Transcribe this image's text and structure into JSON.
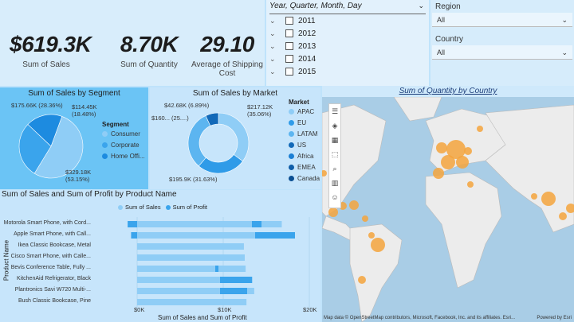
{
  "kpis": {
    "sales": {
      "value": "$619.3K",
      "label": "Sum of Sales"
    },
    "quantity": {
      "value": "8.70K",
      "label": "Sum of Quantity"
    },
    "shipping": {
      "value": "29.10",
      "label": "Average of Shipping Cost"
    }
  },
  "date_slicer": {
    "header": "Year, Quarter, Month, Day",
    "years": [
      "2011",
      "2012",
      "2013",
      "2014",
      "2015"
    ]
  },
  "filters": {
    "region": {
      "title": "Region",
      "value": "All"
    },
    "country": {
      "title": "Country",
      "value": "All"
    }
  },
  "segment_chart": {
    "title": "Sum of Sales by Segment",
    "legend_title": "Segment",
    "labels": [
      "$175.66K (28.36%)",
      "$114.45K (18.48%)",
      "$329.18K (53.15%)"
    ]
  },
  "market_chart": {
    "title": "Sum of Sales by Market",
    "legend_title": "Market",
    "labels": [
      "$42.68K (6.89%)",
      "$160... (25....)",
      "$217.12K (35.06%)",
      "$195.9K (31.63%)"
    ]
  },
  "product_chart": {
    "title": "Sum of Sales and Sum of Profit by Product Name",
    "y_axis_title": "Product Name",
    "x_axis_title": "Sum of Sales and Sum of Profit"
  },
  "map": {
    "title": "Sum of Quantity by Country",
    "attribution": "Map data © OpenStreetMap contributors, Microsoft, Facebook, Inc. and its affiliates. Esri...",
    "logo": "Powered by Esri"
  },
  "chart_data": [
    {
      "type": "pie",
      "title": "Sum of Sales by Segment",
      "categories": [
        "Consumer",
        "Corporate",
        "Home Office"
      ],
      "values": [
        329.18,
        175.66,
        114.45
      ],
      "legend_labels": [
        "Consumer",
        "Corporate",
        "Home Offi..."
      ],
      "unit": "$K",
      "colors": [
        "#8fcdf6",
        "#3aa4ec",
        "#1d8be0"
      ],
      "legend": "right"
    },
    {
      "type": "pie",
      "title": "Sum of Sales by Market",
      "categories": [
        "APAC",
        "EU",
        "LATAM",
        "US",
        "Africa",
        "EMEA",
        "Canada"
      ],
      "values": [
        217.12,
        160.5,
        195.9,
        42.68,
        0,
        0,
        0
      ],
      "unit": "$K",
      "colors": [
        "#8fcdf6",
        "#2f9be8",
        "#5cb5f0",
        "#1269b8",
        "#1b7fd4",
        "#0f5da8",
        "#0b4f93"
      ],
      "legend": "right"
    },
    {
      "type": "bar",
      "title": "Sum of Sales and Sum of Profit by Product Name",
      "categories": [
        "Motorola Smart Phone, with Cord...",
        "Apple Smart Phone, with Call...",
        "Ikea Classic Bookcase, Metal",
        "Cisco Smart Phone, with Calle...",
        "Bevis Conference Table, Fully ...",
        "KitchenAid Refrigerator, Black",
        "Plantronics Savi W720 Multi-...",
        "Bush Classic Bookcase, Pine"
      ],
      "series": [
        {
          "name": "Sum of Sales",
          "values": [
            16.8,
            18.2,
            12.4,
            12.5,
            12.6,
            13.4,
            13.6,
            12.7
          ]
        },
        {
          "name": "Sum of Profit",
          "values": [
            -1.1,
            -0.7,
            0,
            0,
            0,
            0,
            0,
            0
          ]
        }
      ],
      "xticks": [
        "$0K",
        "$10K",
        "$20K"
      ],
      "xlim": [
        -1.5,
        20
      ],
      "xlabel": "Sum of Sales and Sum of Profit",
      "ylabel": "Product Name"
    },
    {
      "type": "bubble_map",
      "title": "Sum of Quantity by Country"
    }
  ]
}
